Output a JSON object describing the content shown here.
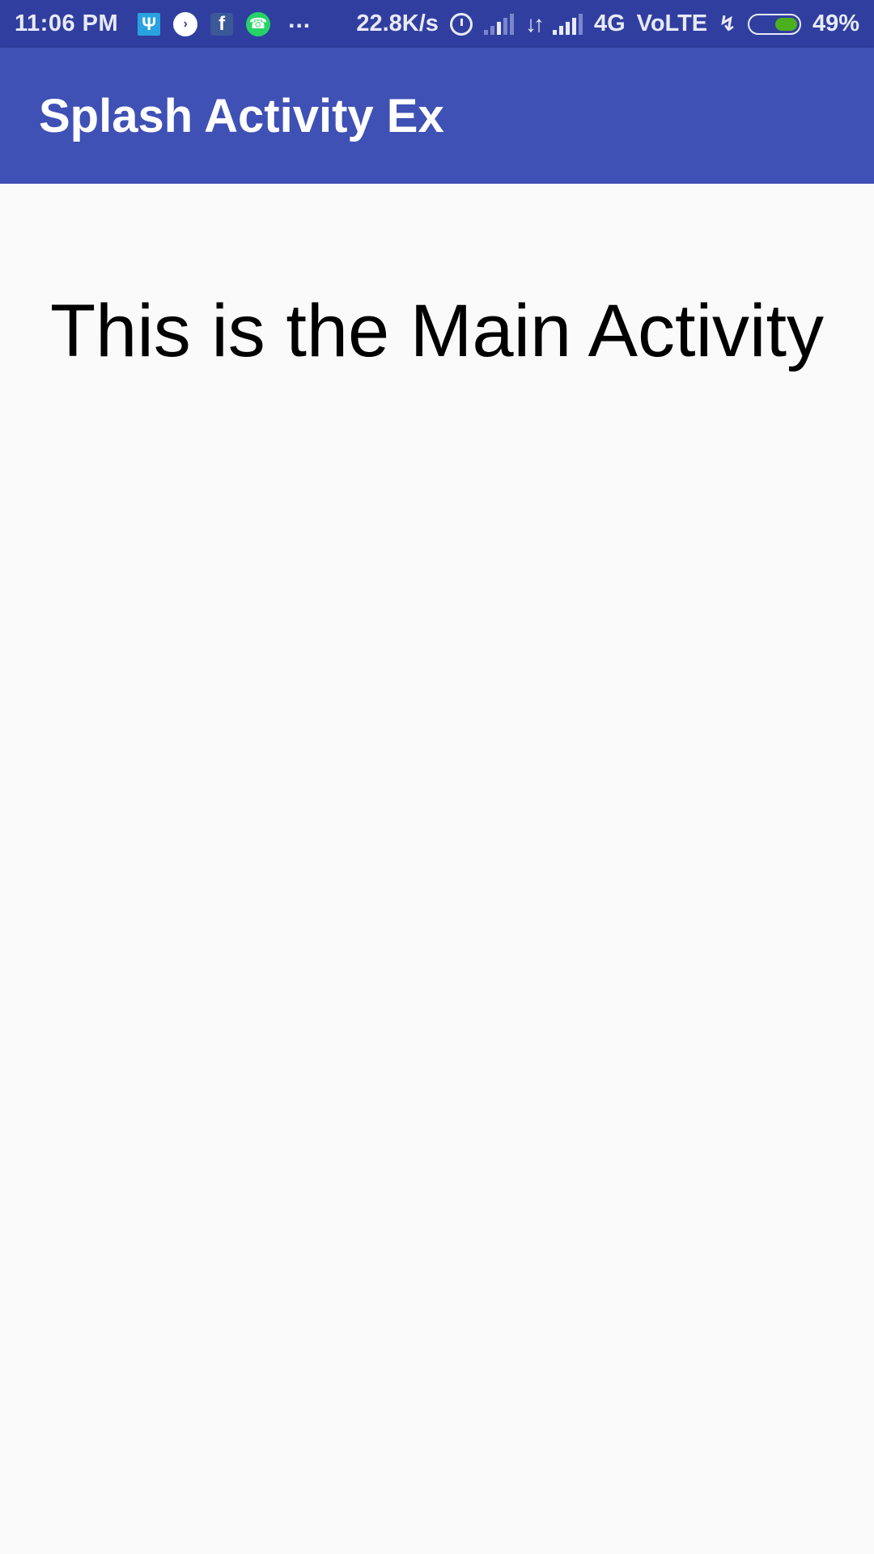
{
  "status_bar": {
    "time": "11:06 PM",
    "notification_icons": [
      "usb-icon",
      "clock-app-icon",
      "facebook-icon",
      "whatsapp-icon"
    ],
    "more": "...",
    "net_speed": "22.8K/s",
    "network_type": "4G",
    "volte": "VoLTE",
    "battery_percent": "49%",
    "battery_level": 0.49,
    "colors": {
      "background": "#303f9f",
      "battery_fill": "#4caf1e"
    }
  },
  "app_bar": {
    "title": "Splash Activity Ex",
    "color": "#3f51b5"
  },
  "main": {
    "text": "This is the Main Activity"
  }
}
